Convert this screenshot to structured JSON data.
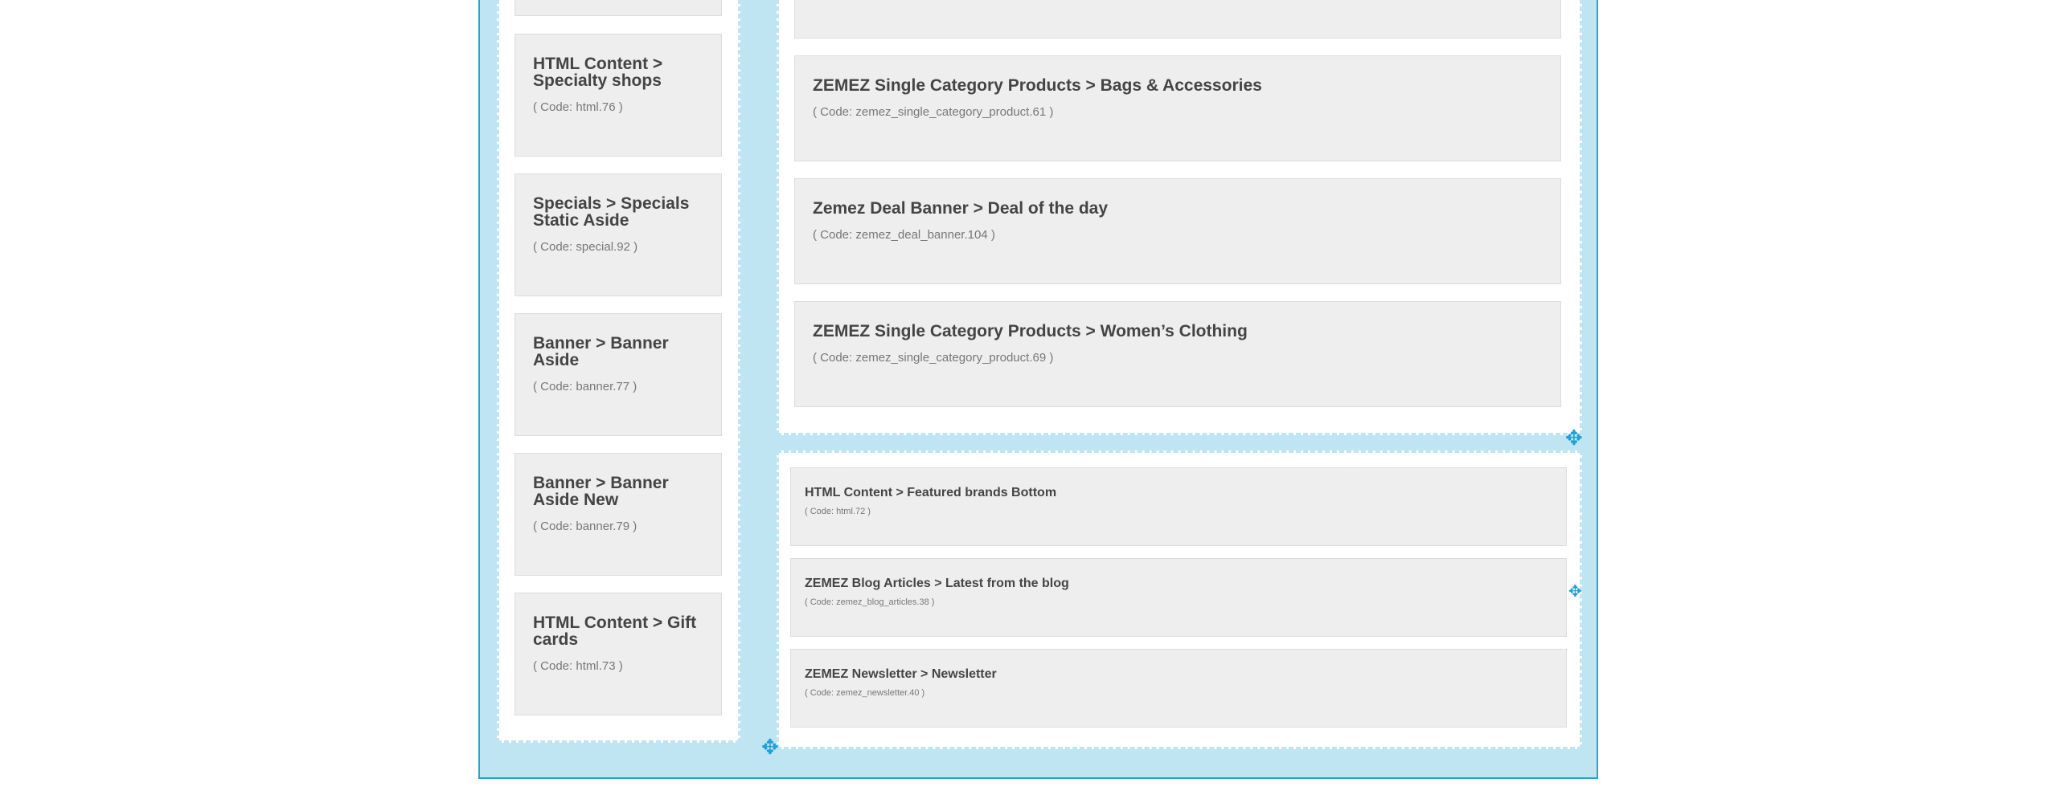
{
  "sidebar": {
    "modules": [
      {
        "title": "",
        "code": ""
      },
      {
        "title": "HTML Content > Specialty shops",
        "code": "( Code: html.76 )"
      },
      {
        "title": "Specials > Specials Static Aside",
        "code": "( Code: special.92 )"
      },
      {
        "title": "Banner > Banner Aside",
        "code": "( Code: banner.77 )"
      },
      {
        "title": "Banner > Banner Aside New",
        "code": "( Code: banner.79 )"
      },
      {
        "title": "HTML Content > Gift cards",
        "code": "( Code: html.73 )"
      }
    ]
  },
  "main_top": {
    "modules": [
      {
        "title": "",
        "code": ""
      },
      {
        "title": "ZEMEZ Single Category Products > Bags & Accessories",
        "code": "( Code: zemez_single_category_product.61 )"
      },
      {
        "title": "Zemez Deal Banner > Deal of the day",
        "code": "( Code: zemez_deal_banner.104 )"
      },
      {
        "title": "ZEMEZ Single Category Products > Women’s Clothing",
        "code": "( Code: zemez_single_category_product.69 )"
      }
    ]
  },
  "main_bottom": {
    "modules": [
      {
        "title": "HTML Content > Featured brands Bottom",
        "code": "( Code: html.72 )"
      },
      {
        "title": "ZEMEZ Blog Articles > Latest from the blog",
        "code": "( Code: zemez_blog_articles.38 )"
      },
      {
        "title": "ZEMEZ Newsletter > Newsletter",
        "code": "( Code: zemez_newsletter.40 )"
      }
    ]
  },
  "icons": {
    "move": "move-arrows-icon"
  },
  "colors": {
    "frame_bg": "#bfe5f3",
    "frame_border": "#2aa3d4",
    "accent": "#1f9fd6",
    "module_bg": "#eeeeee"
  }
}
